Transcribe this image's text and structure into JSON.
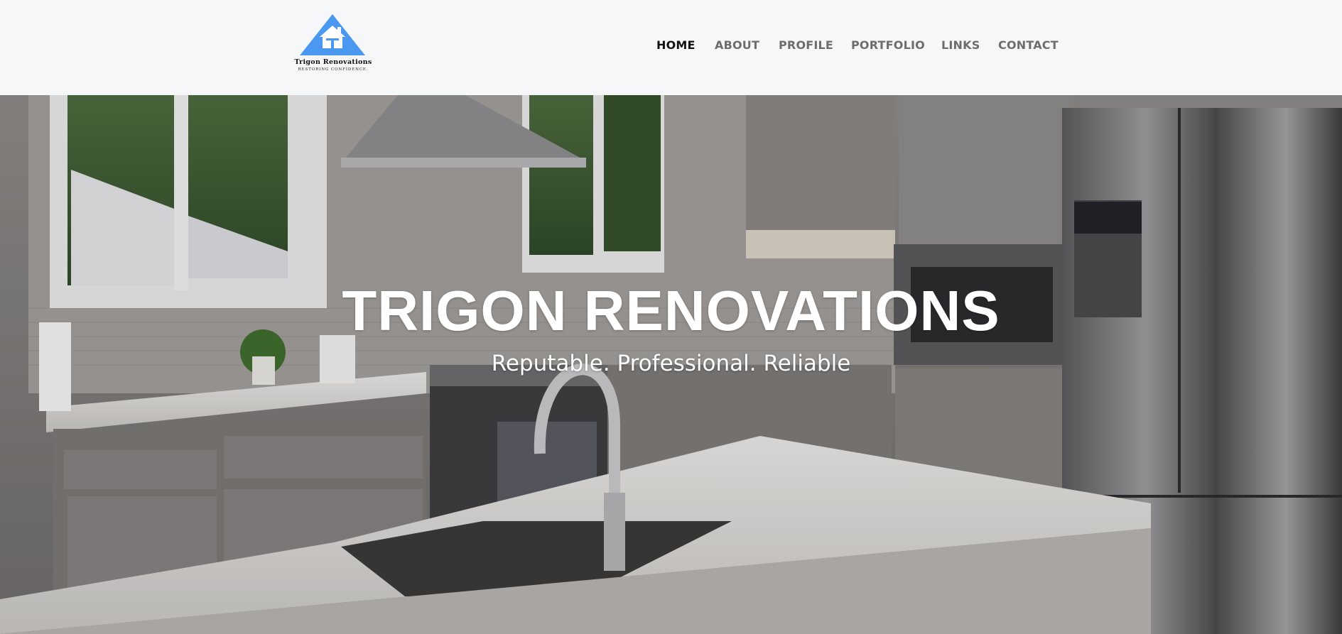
{
  "logo": {
    "brand": "Trigon Renovations",
    "tagline": "RESTORING CONFIDENCE."
  },
  "nav": {
    "items": [
      {
        "label": "HOME",
        "active": true
      },
      {
        "label": "ABOUT"
      },
      {
        "label": "PROFILE"
      },
      {
        "label": "PORTFOLIO"
      },
      {
        "label": "LINKS"
      },
      {
        "label": "CONTACT"
      }
    ]
  },
  "hero": {
    "title": "TRIGON RENOVATIONS",
    "subtitle": "Reputable. Professional. Reliable"
  },
  "colors": {
    "logo_blue": "#4a98f0",
    "nav_active": "#111111",
    "nav_inactive": "#6d6d6d",
    "header_bg": "#f6f7f8"
  }
}
